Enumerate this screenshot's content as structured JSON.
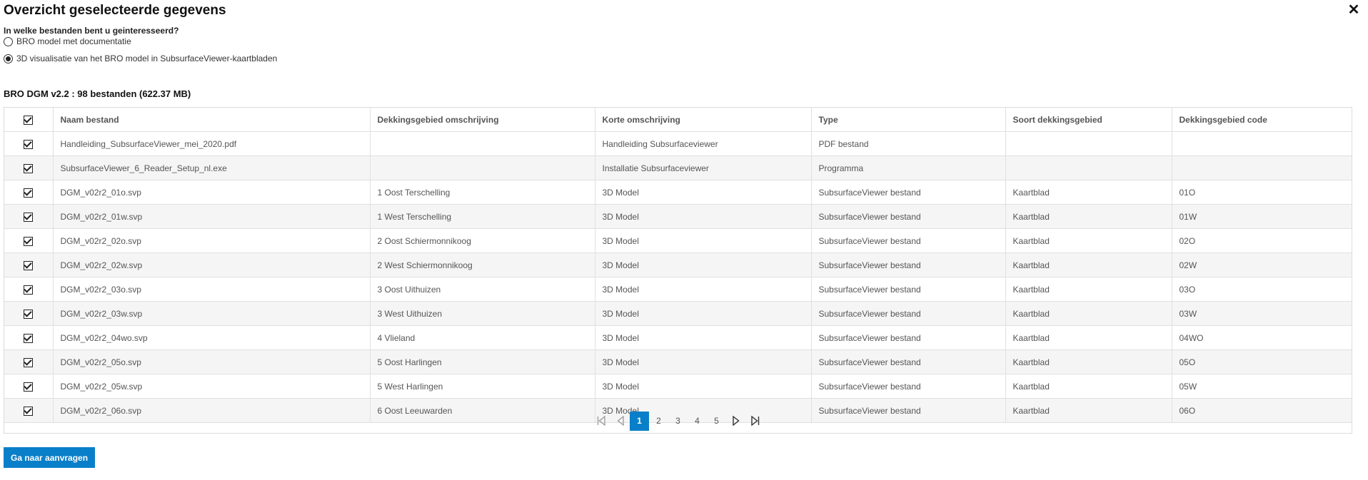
{
  "dialog": {
    "title": "Overzicht geselecteerde gegevens",
    "close_label": "✕",
    "question": "In welke bestanden bent u geinteresseerd?",
    "options": [
      {
        "label": "BRO model met documentatie",
        "checked": false
      },
      {
        "label": "3D visualisatie van het BRO model in SubsurfaceViewer-kaartbladen",
        "checked": true
      }
    ],
    "dataset_title": "BRO DGM v2.2 : 98 bestanden (622.37 MB)",
    "submit_label": "Ga naar aanvragen"
  },
  "table": {
    "columns": [
      "Naam bestand",
      "Dekkingsgebied omschrijving",
      "Korte omschrijving",
      "Type",
      "Soort dekkingsgebied",
      "Dekkingsgebied code"
    ],
    "rows": [
      [
        "Handleiding_SubsurfaceViewer_mei_2020.pdf",
        "",
        "Handleiding Subsurfaceviewer",
        "PDF bestand",
        "",
        ""
      ],
      [
        "SubsurfaceViewer_6_Reader_Setup_nl.exe",
        "",
        "Installatie Subsurfaceviewer",
        "Programma",
        "",
        ""
      ],
      [
        "DGM_v02r2_01o.svp",
        "1 Oost Terschelling",
        "3D Model",
        "SubsurfaceViewer bestand",
        "Kaartblad",
        "01O"
      ],
      [
        "DGM_v02r2_01w.svp",
        "1 West Terschelling",
        "3D Model",
        "SubsurfaceViewer bestand",
        "Kaartblad",
        "01W"
      ],
      [
        "DGM_v02r2_02o.svp",
        "2 Oost Schiermonnikoog",
        "3D Model",
        "SubsurfaceViewer bestand",
        "Kaartblad",
        "02O"
      ],
      [
        "DGM_v02r2_02w.svp",
        "2 West Schiermonnikoog",
        "3D Model",
        "SubsurfaceViewer bestand",
        "Kaartblad",
        "02W"
      ],
      [
        "DGM_v02r2_03o.svp",
        "3 Oost Uithuizen",
        "3D Model",
        "SubsurfaceViewer bestand",
        "Kaartblad",
        "03O"
      ],
      [
        "DGM_v02r2_03w.svp",
        "3 West Uithuizen",
        "3D Model",
        "SubsurfaceViewer bestand",
        "Kaartblad",
        "03W"
      ],
      [
        "DGM_v02r2_04wo.svp",
        "4 Vlieland",
        "3D Model",
        "SubsurfaceViewer bestand",
        "Kaartblad",
        "04WO"
      ],
      [
        "DGM_v02r2_05o.svp",
        "5 Oost Harlingen",
        "3D Model",
        "SubsurfaceViewer bestand",
        "Kaartblad",
        "05O"
      ],
      [
        "DGM_v02r2_05w.svp",
        "5 West Harlingen",
        "3D Model",
        "SubsurfaceViewer bestand",
        "Kaartblad",
        "05W"
      ],
      [
        "DGM_v02r2_06o.svp",
        "6 Oost Leeuwarden",
        "3D Model",
        "SubsurfaceViewer bestand",
        "Kaartblad",
        "06O"
      ]
    ]
  },
  "pagination": {
    "pages": [
      "1",
      "2",
      "3",
      "4",
      "5"
    ],
    "active": "1"
  },
  "colors": {
    "accent": "#0a7fc9"
  }
}
